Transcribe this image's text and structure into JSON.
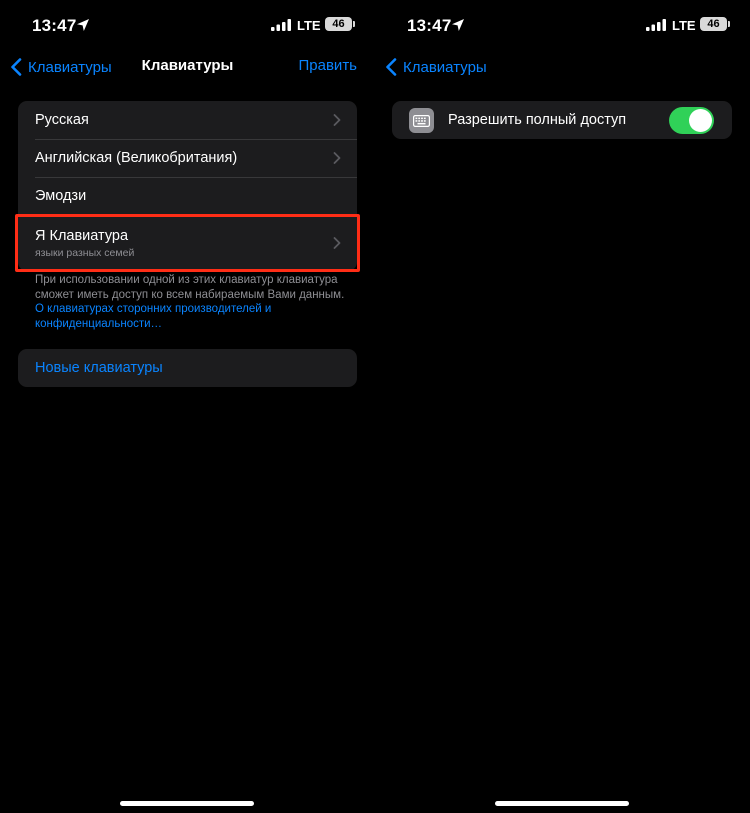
{
  "status": {
    "time": "13:47",
    "network": "LTE",
    "battery": "46"
  },
  "left": {
    "nav": {
      "back_label": "Клавиатуры",
      "title": "Клавиатуры",
      "edit_label": "Править"
    },
    "keyboards": [
      {
        "label": "Русская"
      },
      {
        "label": "Английская (Великобритания)"
      },
      {
        "label": "Эмодзи"
      },
      {
        "label": "Я Клавиатура",
        "subtitle": "языки разных семей"
      }
    ],
    "footnote": {
      "text": "При использовании одной из этих клавиатур клавиатура сможет иметь доступ ко всем набираемым Вами данным.",
      "link": "О клавиатурах сторонних производителей и конфиденциальности…"
    },
    "new_keyboards_label": "Новые клавиатуры"
  },
  "right": {
    "nav": {
      "back_label": "Клавиатуры"
    },
    "full_access": {
      "label": "Разрешить полный доступ",
      "enabled": true
    }
  },
  "colors": {
    "accent": "#0a84ff",
    "toggle_on": "#30d158",
    "highlight": "#ff2d16",
    "cell": "#1c1c1e"
  }
}
